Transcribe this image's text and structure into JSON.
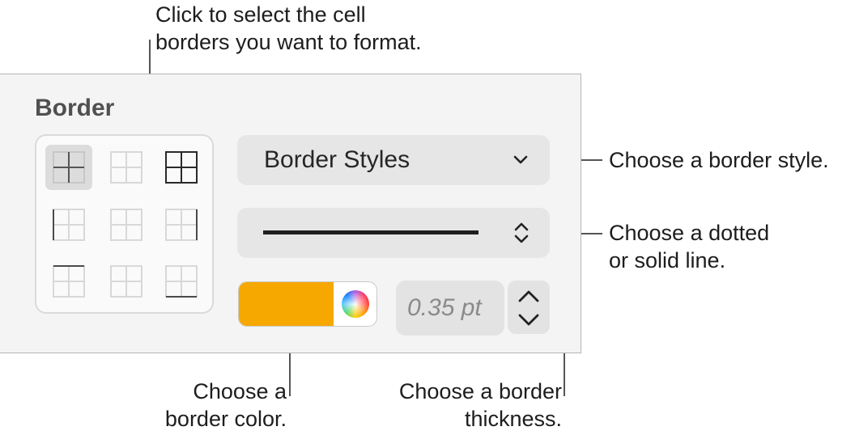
{
  "callouts": {
    "select_borders": "Click to select the cell\nborders you want to format.",
    "border_style": "Choose a border style.",
    "dotted_line_1": "Choose a dotted",
    "dotted_line_2": "or solid line.",
    "color_1": "Choose a",
    "color_2": "border color.",
    "thickness_1": "Choose a border",
    "thickness_2": "thickness."
  },
  "panel": {
    "title": "Border",
    "border_styles_label": "Border Styles",
    "thickness_value": "0.35 pt",
    "color_swatch": "#f7a800"
  },
  "icons": {
    "dropdown": "chevron-down-icon",
    "line_style": "up-down-chevron-icon",
    "stepper_up": "chevron-up-icon",
    "stepper_down": "chevron-down-icon",
    "color_picker": "color-wheel-icon"
  },
  "border_buttons": [
    "inside-borders",
    "no-borders",
    "all-borders",
    "left-border",
    "inner-vertical",
    "right-border",
    "top-border",
    "inner-horizontal",
    "bottom-border"
  ]
}
